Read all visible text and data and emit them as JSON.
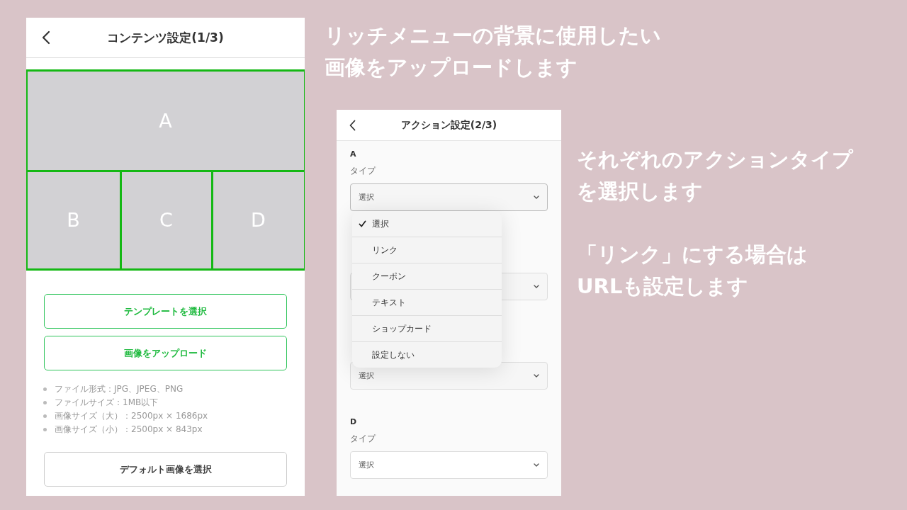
{
  "captions": [
    {
      "paragraphs": [
        [
          "リッチメニューの背景に使用したい",
          "画像をアップロードします"
        ]
      ]
    },
    {
      "paragraphs": [
        [
          "それぞれのアクションタイプ",
          "を選択します"
        ],
        [
          "「リンク」にする場合は",
          "URLも設定します"
        ]
      ]
    }
  ],
  "content_screen": {
    "title": "コンテンツ設定(1/3)",
    "areas": [
      {
        "label": "A"
      },
      {
        "label": "B"
      },
      {
        "label": "C"
      },
      {
        "label": "D"
      }
    ],
    "buttons": [
      {
        "label": "テンプレートを選択",
        "kind": "primary"
      },
      {
        "label": "画像をアップロード",
        "kind": "primary"
      }
    ],
    "notes": [
      "ファイル形式：JPG、JPEG、PNG",
      "ファイルサイズ：1MB以下",
      "画像サイズ（大）：2500px × 1686px",
      "画像サイズ（小）：2500px × 843px"
    ],
    "default_button": {
      "label": "デフォルト画像を選択",
      "kind": "secondary"
    }
  },
  "action_screen": {
    "title": "アクション設定(2/3)",
    "sections": [
      {
        "kind": "field",
        "area": "A",
        "type_label": "タイプ",
        "value": "選択"
      },
      {
        "kind": "covered"
      },
      {
        "kind": "covered",
        "value": "選択"
      },
      {
        "kind": "field",
        "area": "D",
        "type_label": "タイプ",
        "value": "選択"
      }
    ],
    "dropdown": {
      "options": [
        {
          "label": "選択",
          "selected": true
        },
        {
          "label": "リンク",
          "selected": false
        },
        {
          "label": "クーポン",
          "selected": false
        },
        {
          "label": "テキスト",
          "selected": false
        },
        {
          "label": "ショップカード",
          "selected": false
        },
        {
          "label": "設定しない",
          "selected": false
        }
      ]
    }
  }
}
